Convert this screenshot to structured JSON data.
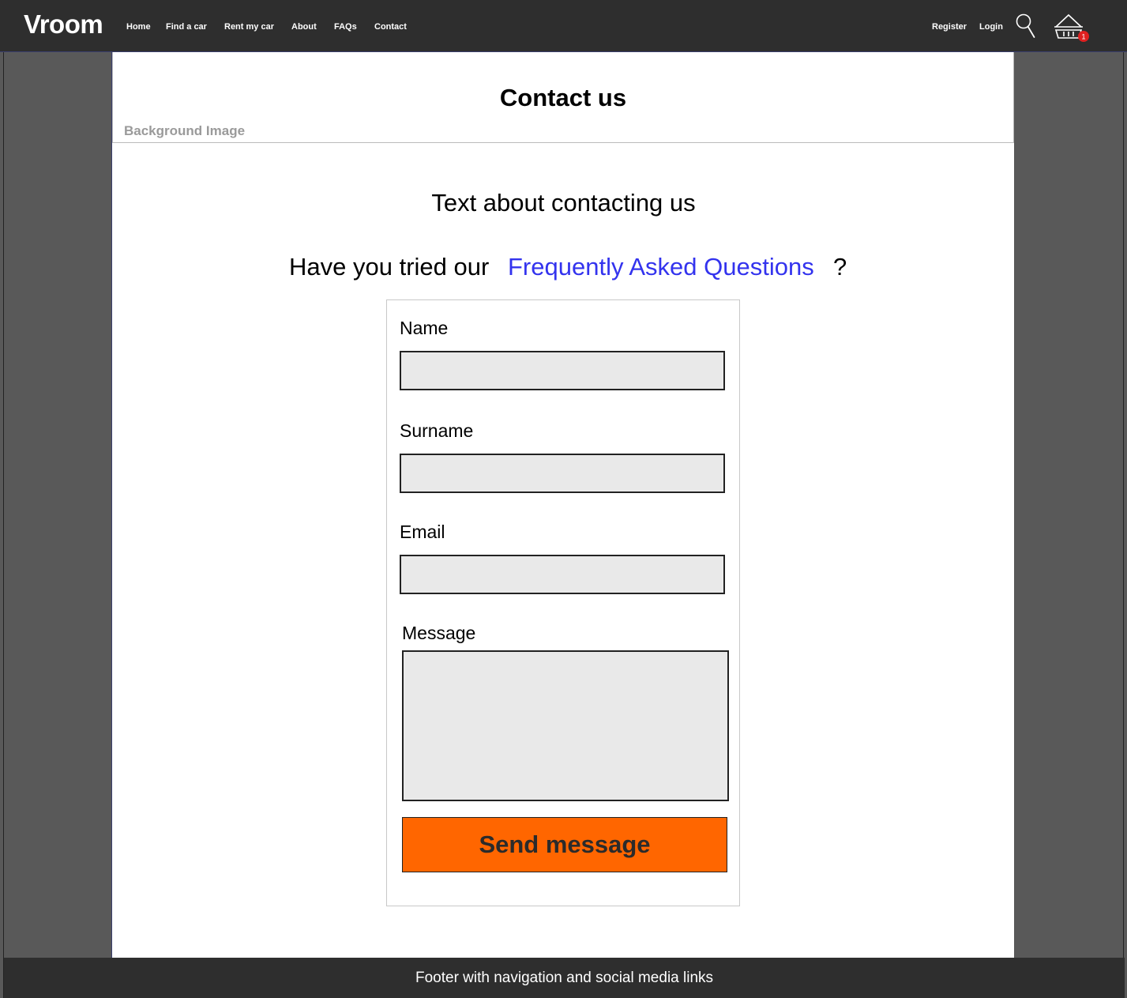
{
  "header": {
    "logo": "Vroom",
    "nav": [
      "Home",
      "Find a car",
      "Rent my car",
      "About",
      "FAQs",
      "Contact"
    ],
    "register": "Register",
    "login": "Login",
    "basket_count": "1",
    "icons": {
      "search": "search-icon",
      "basket": "basket-icon"
    }
  },
  "hero": {
    "title": "Contact us",
    "background_label": "Background Image"
  },
  "main": {
    "intro": "Text about contacting us",
    "faq_prefix": "Have you tried our",
    "faq_link": "Frequently Asked Questions",
    "faq_suffix": "?"
  },
  "form": {
    "name_label": "Name",
    "name_value": "",
    "surname_label": "Surname",
    "surname_value": "",
    "email_label": "Email",
    "email_value": "",
    "message_label": "Message",
    "message_value": "",
    "submit_label": "Send message"
  },
  "footer": {
    "text": "Footer with navigation and social media links"
  },
  "colors": {
    "nav_bg": "#2e2e2e",
    "side_bg": "#595959",
    "accent": "#ff6600",
    "link": "#3333ee",
    "input_bg": "#e9e9e9",
    "badge": "#e02020"
  }
}
